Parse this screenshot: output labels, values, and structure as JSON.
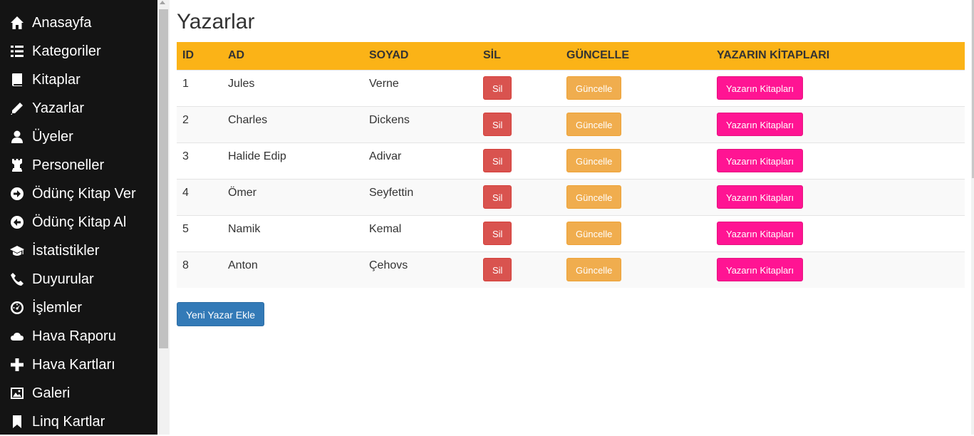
{
  "sidebar": {
    "items": [
      {
        "label": "Anasayfa",
        "icon": "home-icon"
      },
      {
        "label": "Kategoriler",
        "icon": "list-icon"
      },
      {
        "label": "Kitaplar",
        "icon": "book-icon"
      },
      {
        "label": "Yazarlar",
        "icon": "pencil-icon"
      },
      {
        "label": "Üyeler",
        "icon": "user-icon"
      },
      {
        "label": "Personeller",
        "icon": "tower-icon"
      },
      {
        "label": "Ödünç Kitap Ver",
        "icon": "circle-arrow-right-icon"
      },
      {
        "label": "Ödünç Kitap Al",
        "icon": "circle-arrow-left-icon"
      },
      {
        "label": "İstatistikler",
        "icon": "education-icon"
      },
      {
        "label": "Duyurular",
        "icon": "phone-icon"
      },
      {
        "label": "İşlemler",
        "icon": "dashboard-icon"
      },
      {
        "label": "Hava Raporu",
        "icon": "cloud-icon"
      },
      {
        "label": "Hava Kartları",
        "icon": "plus-icon"
      },
      {
        "label": "Galeri",
        "icon": "picture-icon"
      },
      {
        "label": "Linq Kartlar",
        "icon": "bookmark-icon"
      }
    ]
  },
  "page": {
    "title": "Yazarlar"
  },
  "table": {
    "headers": {
      "id": "ID",
      "ad": "AD",
      "soyad": "SOYAD",
      "sil": "SİL",
      "guncelle": "GÜNCELLE",
      "kitaplar": "YAZARIN KİTAPLARI"
    },
    "rows": [
      {
        "id": "1",
        "ad": "Jules",
        "soyad": "Verne"
      },
      {
        "id": "2",
        "ad": "Charles",
        "soyad": "Dickens"
      },
      {
        "id": "3",
        "ad": "Halide Edip",
        "soyad": "Adivar"
      },
      {
        "id": "4",
        "ad": "Ömer",
        "soyad": "Seyfettin"
      },
      {
        "id": "5",
        "ad": "Namik",
        "soyad": "Kemal"
      },
      {
        "id": "8",
        "ad": "Anton",
        "soyad": "Çehovs"
      }
    ],
    "buttons": {
      "delete": "Sil",
      "update": "Güncelle",
      "books": "Yazarın Kitapları"
    }
  },
  "add_button": "Yeni Yazar Ekle",
  "colors": {
    "sidebar_bg": "#141414",
    "header_bg": "#fbb317",
    "danger": "#d9534f",
    "warning": "#f0ad4e",
    "pink": "#ff1493",
    "primary": "#337ab7"
  }
}
